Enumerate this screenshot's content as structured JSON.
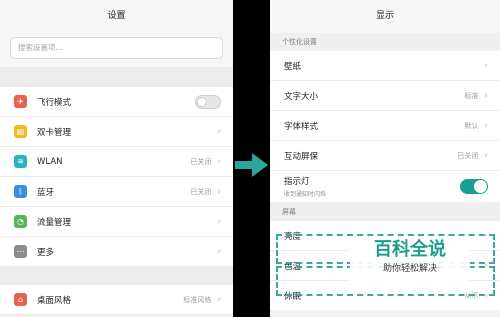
{
  "left": {
    "title": "设置",
    "search_placeholder": "搜索设置项...",
    "items": [
      {
        "label": "飞行模式",
        "icon": "airplane-icon",
        "color": "#e8624e",
        "glyph": "✈",
        "value": "",
        "control": "toggle-off"
      },
      {
        "label": "双卡管理",
        "icon": "sim-card-icon",
        "color": "#f5b928",
        "glyph": "▤",
        "value": "",
        "control": "chevron"
      },
      {
        "label": "WLAN",
        "icon": "wifi-icon",
        "color": "#2bb3c0",
        "glyph": "≋",
        "value": "已关闭",
        "control": "chevron"
      },
      {
        "label": "蓝牙",
        "icon": "bluetooth-icon",
        "color": "#3d8ee0",
        "glyph": "ᛒ",
        "value": "已关闭",
        "control": "chevron"
      },
      {
        "label": "流量管理",
        "icon": "data-usage-icon",
        "color": "#59b65b",
        "glyph": "◔",
        "value": "",
        "control": "chevron"
      },
      {
        "label": "更多",
        "icon": "more-icon",
        "color": "#8c8c8c",
        "glyph": "⋯",
        "value": "",
        "control": "chevron"
      }
    ],
    "bottom_item": {
      "label": "桌面风格",
      "icon": "home-icon",
      "color": "#e8624e",
      "glyph": "⌂",
      "value": "标准风格"
    }
  },
  "right": {
    "title": "显示",
    "section_personal": "个性化设置",
    "items": [
      {
        "label": "壁纸",
        "value": ""
      },
      {
        "label": "文字大小",
        "value": "标准"
      },
      {
        "label": "字体样式",
        "value": "默认"
      },
      {
        "label": "互动屏保",
        "value": "已关闭"
      }
    ],
    "indicator": {
      "label": "指示灯",
      "sub": "收到通知时闪烁",
      "state": "on"
    },
    "section_screen": "屏幕",
    "screen_items": [
      {
        "label": "亮度",
        "value": ""
      },
      {
        "label": "色温",
        "value": ""
      },
      {
        "label": "休眠",
        "value": "从不"
      }
    ]
  },
  "watermark": {
    "title": "百科全说",
    "sub": "助你轻松解决"
  },
  "accent": "#1a9f8c"
}
